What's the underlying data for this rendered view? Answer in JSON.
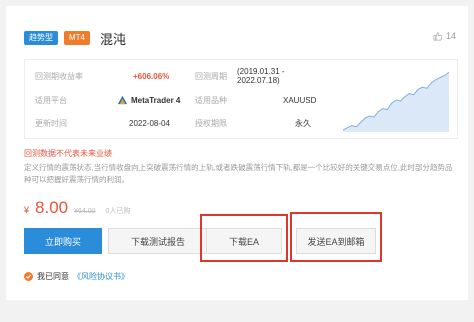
{
  "header": {
    "tag_type": "趋势型",
    "tag_platform": "MT4",
    "title": "混沌",
    "like_count": "14"
  },
  "info": {
    "row1": {
      "label1": "回测期收益率",
      "value1": "+606.06%",
      "label2": "回测周期",
      "value2": "(2019.01.31 - 2022.07.18)"
    },
    "row2": {
      "label1": "适用平台",
      "value1": "MetaTrader 4",
      "label2": "适用品种",
      "value2": "XAUUSD"
    },
    "row3": {
      "label1": "更新时间",
      "value1": "2022-08-04",
      "label2": "授权期限",
      "value2": "永久"
    }
  },
  "disclaimer": "回测数据不代表未来业绩",
  "description": "定义行情的震荡状态,当行情收盘向上突破震荡行情的上轨,或者跌破震荡行情下轨,都是一个比较好的关键交易点位,此时部分趋势品种可以把握好震荡行情的利润。",
  "price": {
    "currency": "¥",
    "current": "8.00",
    "original": "¥64.00",
    "sold": "0人已购"
  },
  "buttons": {
    "buy": "立即购买",
    "download_report": "下载测试报告",
    "download_ea": "下载EA",
    "send_email": "发送EA到邮箱"
  },
  "agreement": {
    "prefix": "我已同意",
    "link": "《风险协议书》"
  },
  "colors": {
    "accent_blue": "#2b8dd9",
    "accent_orange": "#f07b2b",
    "price_red": "#e8533a",
    "highlight_frame": "#d93a2b"
  },
  "chart_data": {
    "type": "area",
    "x": [
      0,
      1,
      2,
      3,
      4,
      5,
      6,
      7,
      8,
      9,
      10,
      11,
      12,
      13,
      14,
      15,
      16,
      17,
      18,
      19,
      20,
      21,
      22,
      23,
      24
    ],
    "values": [
      2,
      4,
      6,
      5,
      9,
      13,
      15,
      14,
      19,
      22,
      21,
      27,
      30,
      29,
      33,
      36,
      35,
      40,
      42,
      41,
      46,
      49,
      51,
      53,
      56
    ],
    "ylim": [
      0,
      60
    ]
  }
}
